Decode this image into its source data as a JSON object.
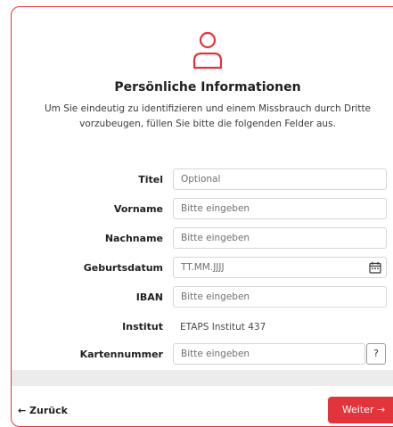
{
  "header": {
    "icon": "person-outline-icon",
    "title": "Persönliche Informationen",
    "subtitle": "Um Sie eindeutig zu identifizieren und einem Missbrauch durch Dritte vorzubeugen, füllen Sie bitte die folgenden Felder aus."
  },
  "form": {
    "titel": {
      "label": "Titel",
      "placeholder": "Optional"
    },
    "vorname": {
      "label": "Vorname",
      "placeholder": "Bitte eingeben"
    },
    "nachname": {
      "label": "Nachname",
      "placeholder": "Bitte eingeben"
    },
    "geburtsdatum": {
      "label": "Geburtsdatum",
      "placeholder": "TT.MM.JJJJ",
      "icon": "calendar-icon"
    },
    "iban": {
      "label": "IBAN",
      "placeholder": "Bitte eingeben"
    },
    "institut": {
      "label": "Institut",
      "value": "ETAPS Institut 437"
    },
    "kartennummer": {
      "label": "Kartennummer",
      "placeholder": "Bitte eingeben",
      "help": "?"
    }
  },
  "footer": {
    "back": "← Zurück",
    "next": "Weiter →"
  },
  "colors": {
    "accent": "#e2353b",
    "border": "#d6d6d6"
  }
}
